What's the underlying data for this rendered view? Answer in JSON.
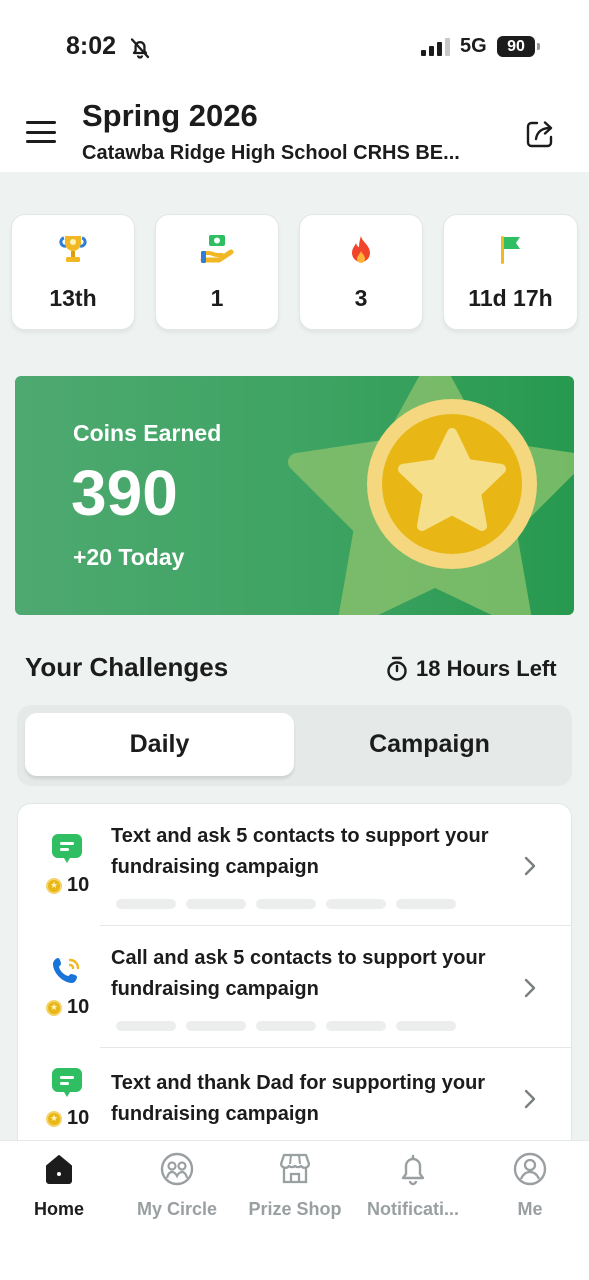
{
  "status_bar": {
    "time": "8:02",
    "network": "5G",
    "battery": "90"
  },
  "header": {
    "title": "Spring 2026",
    "subtitle": "Catawba Ridge High School CRHS BE..."
  },
  "stats": [
    {
      "icon": "trophy-icon",
      "value": "13th"
    },
    {
      "icon": "hand-money-icon",
      "value": "1"
    },
    {
      "icon": "flame-icon",
      "value": "3"
    },
    {
      "icon": "flag-icon",
      "value": "11d 17h"
    }
  ],
  "coins": {
    "label": "Coins Earned",
    "value": "390",
    "today": "+20 Today"
  },
  "challenges": {
    "title": "Your Challenges",
    "time_left": "18 Hours Left",
    "tabs": [
      {
        "label": "Daily",
        "active": true
      },
      {
        "label": "Campaign",
        "active": false
      }
    ],
    "items": [
      {
        "icon": "chat-bubble-icon",
        "coins": "10",
        "text": "Text and ask 5 contacts to support your fundraising campaign",
        "progress_segments": 5,
        "progress_done": 0
      },
      {
        "icon": "phone-call-icon",
        "coins": "10",
        "text": "Call and ask 5 contacts to support your fundraising campaign",
        "progress_segments": 5,
        "progress_done": 0
      },
      {
        "icon": "chat-bubble-icon",
        "coins": "10",
        "text": "Text and thank Dad for supporting your fundraising campaign"
      }
    ]
  },
  "nav": [
    {
      "label": "Home",
      "icon": "home-icon",
      "active": true
    },
    {
      "label": "My Circle",
      "icon": "circle-people-icon",
      "active": false
    },
    {
      "label": "Prize Shop",
      "icon": "shop-icon",
      "active": false
    },
    {
      "label": "Notificati...",
      "icon": "bell-icon",
      "active": false
    },
    {
      "label": "Me",
      "icon": "profile-icon",
      "active": false
    }
  ],
  "colors": {
    "accent_green": "#3da362",
    "coin_gold": "#e9b715",
    "chat_green": "#2fbf62",
    "phone_blue": "#1a73d9"
  }
}
